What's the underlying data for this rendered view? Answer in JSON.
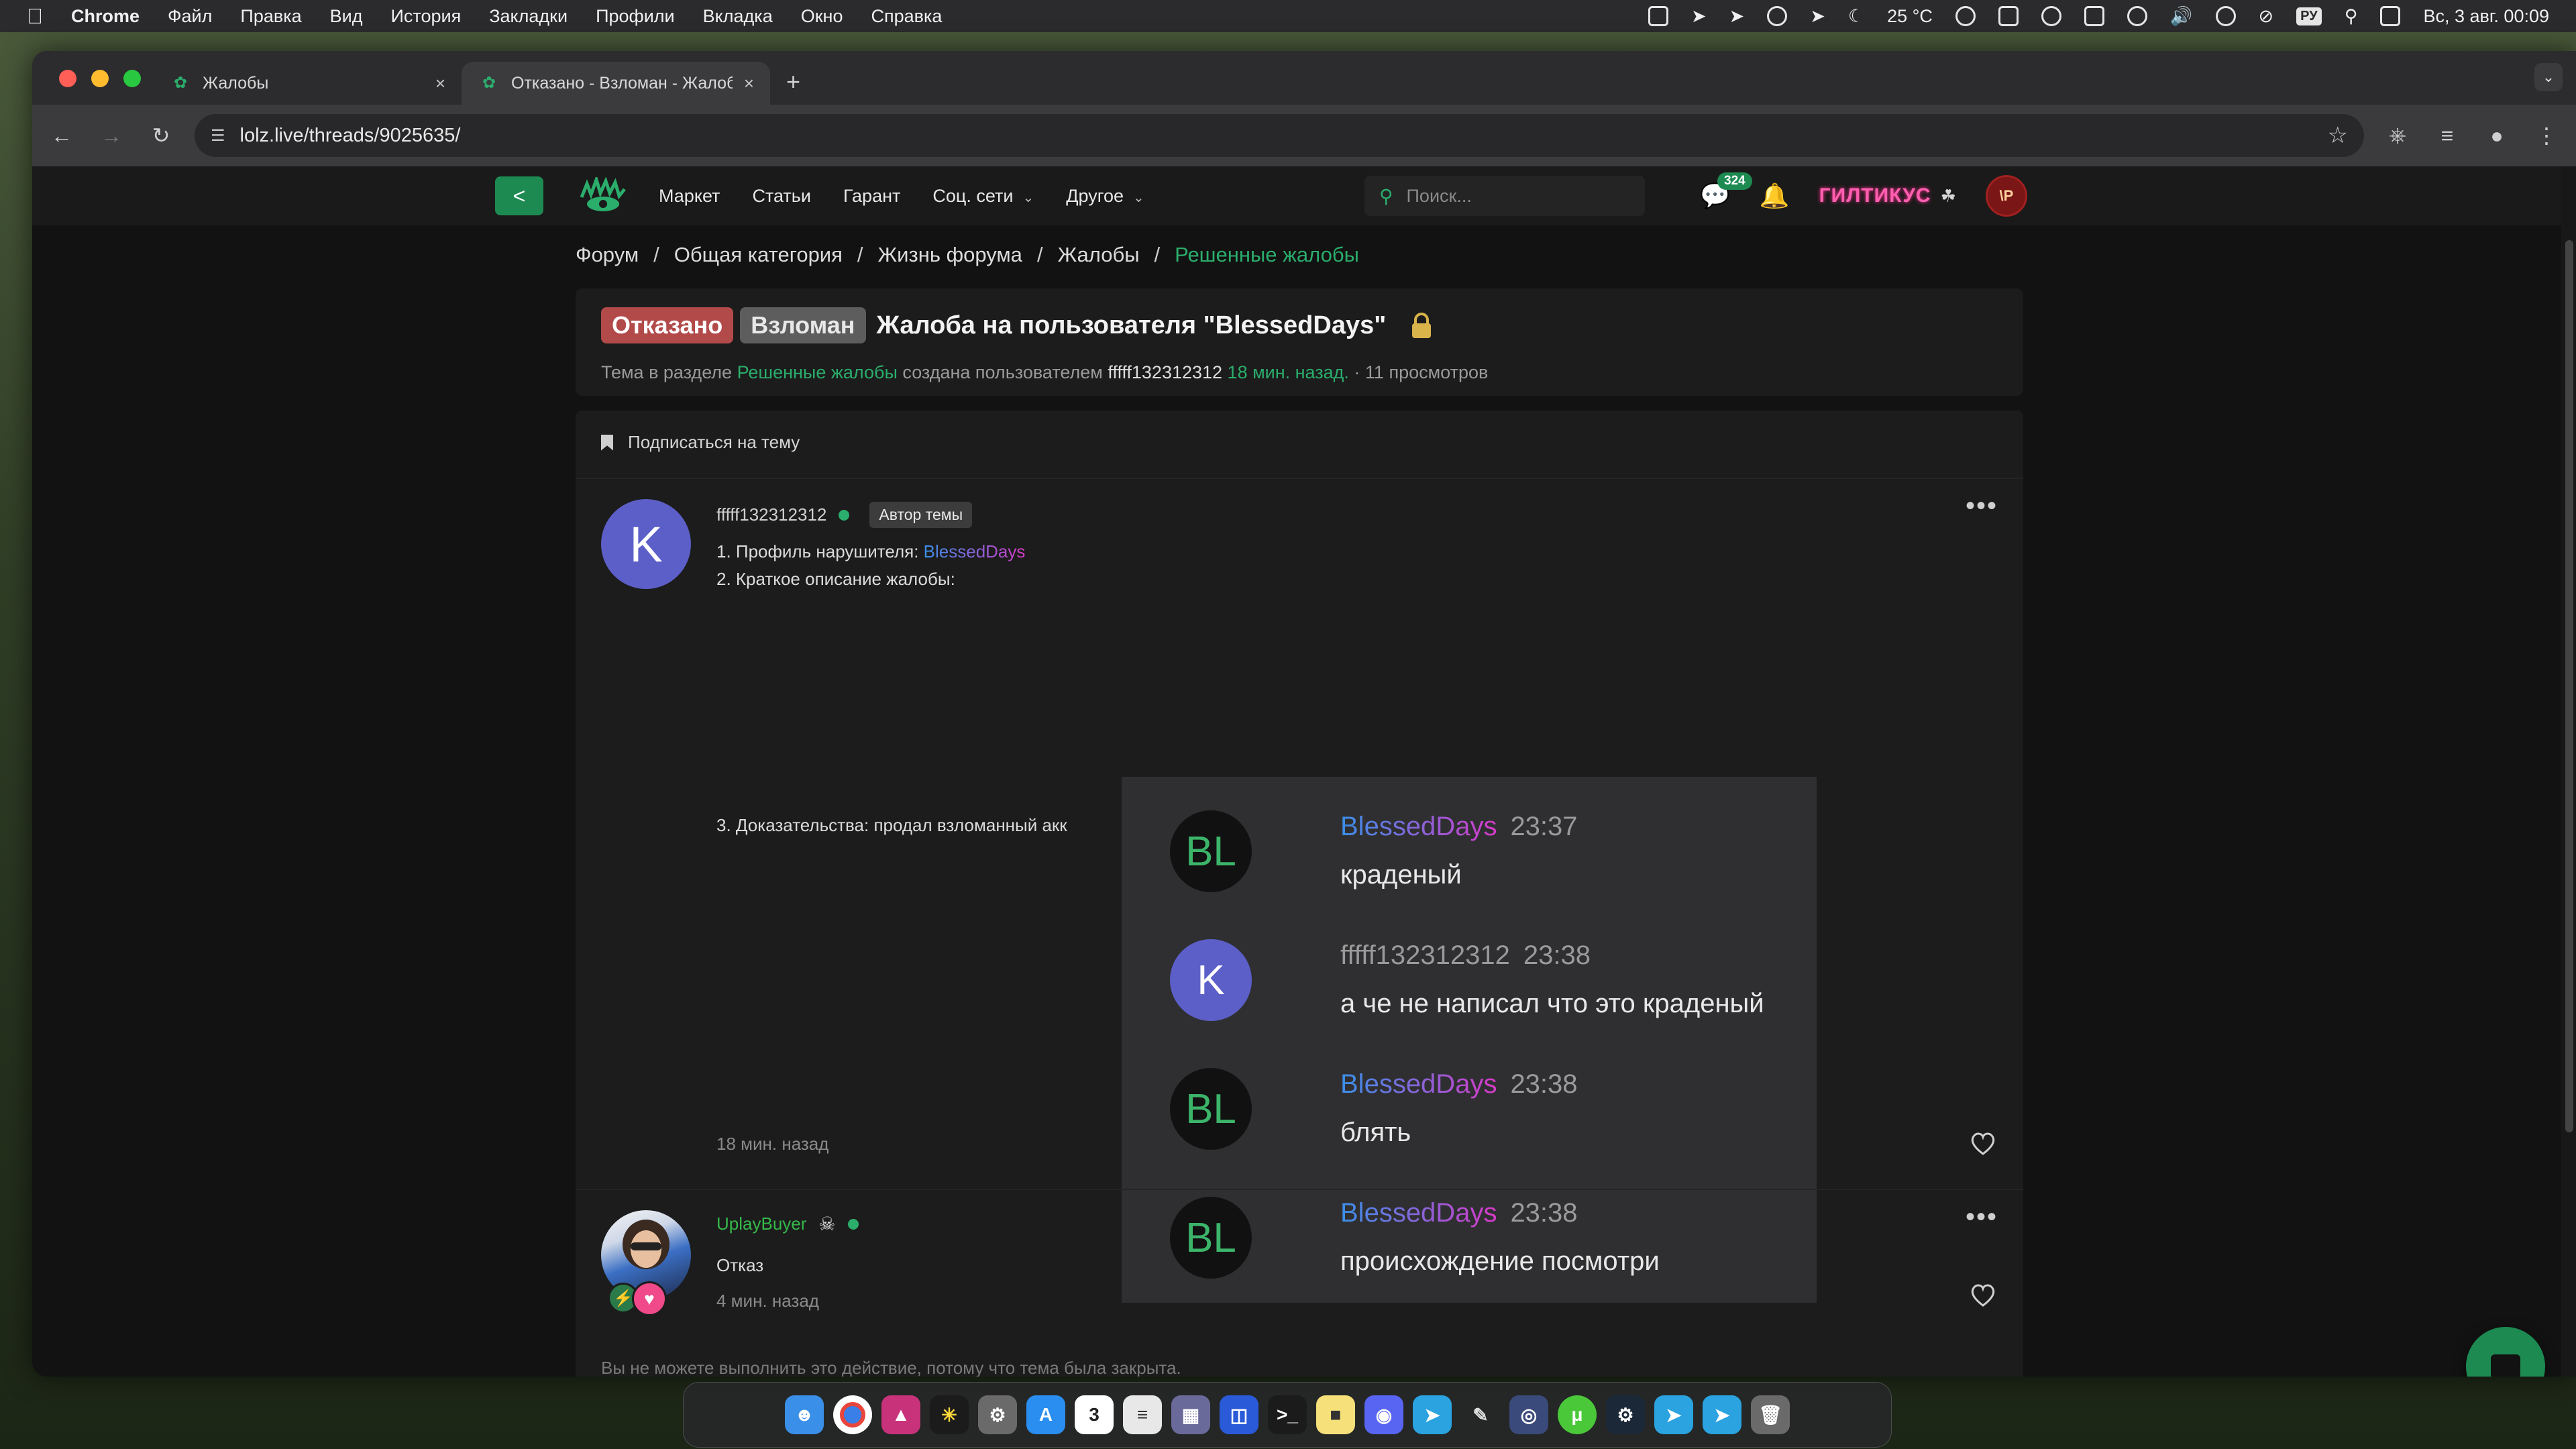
{
  "menubar": {
    "app": "Chrome",
    "items": [
      "Файл",
      "Правка",
      "Вид",
      "История",
      "Закладки",
      "Профили",
      "Вкладка",
      "Окно",
      "Справка"
    ],
    "temperature": "25 °C",
    "lang": "РУ",
    "datetime": "Вс, 3 авг.  00:09"
  },
  "browser": {
    "tabs": [
      {
        "title": "Жалобы",
        "close": "×"
      },
      {
        "title": "Отказано - Взломан - Жалоба",
        "close": "×"
      }
    ],
    "new_tab": "+",
    "url": "lolz.live/threads/9025635/"
  },
  "site": {
    "nav": {
      "back": "<",
      "links": [
        "Маркет",
        "Статьи",
        "Гарант",
        "Соц. сети",
        "Другое"
      ],
      "search_placeholder": "Поиск...",
      "chat_count": "324",
      "username": "ГИЛТИКУС",
      "user_avatar": "\\P"
    },
    "breadcrumbs": [
      "Форум",
      "Общая категория",
      "Жизнь форума",
      "Жалобы",
      "Решенные жалобы"
    ],
    "thread": {
      "prefix1": "Отказано",
      "prefix2": "Взломан",
      "title": "Жалоба на пользователя \"BlessedDays\"",
      "meta_pre": "Тема в разделе ",
      "meta_section": "Решенные жалобы",
      "meta_mid": " создана пользователем ",
      "meta_author": "fffff132312312",
      "meta_time": " 18 мин. назад.",
      "meta_views": " · 11 просмотров",
      "subscribe": "Подписаться на тему"
    },
    "posts": [
      {
        "avatar_letter": "K",
        "username": "fffff132312312",
        "badge": "Автор темы",
        "line1_pre": "1. Профиль нарушителя: ",
        "line1_link": "BlessedDays",
        "line2": "2. Краткое описание жалобы:",
        "line3": "3. Доказательства: продал взломанный акк",
        "time": "18 мин. назад"
      },
      {
        "username": "UplayBuyer",
        "text": "Отказ",
        "time": "4 мин. назад"
      }
    ],
    "screenshot_msgs": [
      {
        "avatar": "BL",
        "name": "BlessedDays",
        "time": "23:37",
        "text": "краденый"
      },
      {
        "avatar": "K",
        "name": "fffff132312312",
        "time": "23:38",
        "text": "а че не написал что это краденый"
      },
      {
        "avatar": "BL",
        "name": "BlessedDays",
        "time": "23:38",
        "text": "блять"
      },
      {
        "avatar": "BL",
        "name": "BlessedDays",
        "time": "23:38",
        "text": "происхождение посмотри"
      }
    ],
    "closed_notice": "Вы не можете выполнить это действие, потому что тема была закрыта."
  },
  "dock": {
    "apps": [
      "finder-icon",
      "chrome-icon",
      "affinity-icon",
      "spark-icon",
      "settings-icon",
      "appstore-icon",
      "calendar-icon",
      "notes-icon",
      "launchpad-icon",
      "bitwarden-icon",
      "terminal-icon",
      "stickies-icon",
      "discord-icon",
      "telegram-icon",
      "pen-icon",
      "chromium-icon",
      "utorrent-icon",
      "steam-icon",
      "telegram2-icon",
      "telegram3-icon",
      "trash-icon"
    ],
    "calendar_day": "3"
  },
  "colors": {
    "accent": "#2bad6c",
    "prefix_red": "#b34a4a",
    "prefix_gray": "#5d5d5d"
  }
}
